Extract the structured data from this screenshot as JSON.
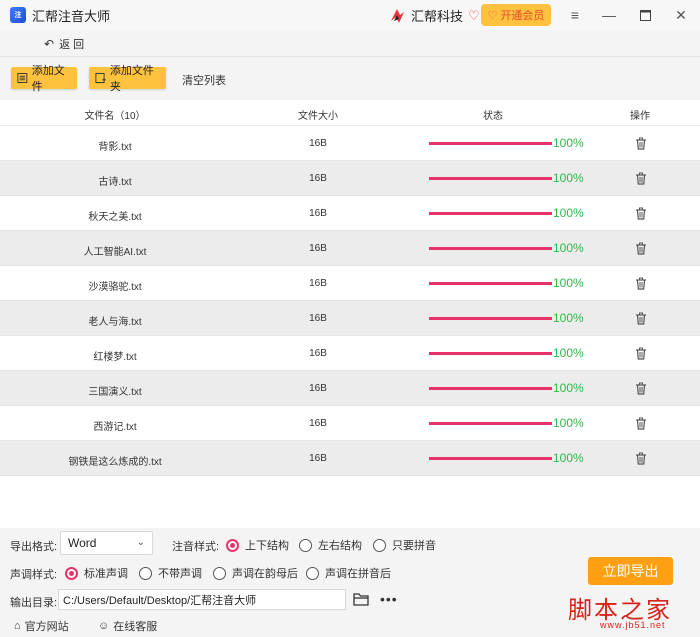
{
  "titlebar": {
    "app_title": "汇帮注音大师",
    "brand_name": "汇帮科技",
    "vip_label": "开通会员"
  },
  "nav": {
    "back_label": "返 回"
  },
  "toolbar": {
    "add_file_label": "添加文件",
    "add_folder_label": "添加文件夹",
    "clear_list_label": "清空列表"
  },
  "table": {
    "headers": {
      "filename": "文件名（10）",
      "size": "文件大小",
      "status": "状态",
      "action": "操作"
    },
    "rows": [
      {
        "name": "背影.txt",
        "size": "16B",
        "progress": 100,
        "pct": "100%"
      },
      {
        "name": "古诗.txt",
        "size": "16B",
        "progress": 100,
        "pct": "100%"
      },
      {
        "name": "秋天之美.txt",
        "size": "16B",
        "progress": 100,
        "pct": "100%"
      },
      {
        "name": "人工智能AI.txt",
        "size": "16B",
        "progress": 100,
        "pct": "100%"
      },
      {
        "name": "沙漠骆驼.txt",
        "size": "16B",
        "progress": 100,
        "pct": "100%"
      },
      {
        "name": "老人与海.txt",
        "size": "16B",
        "progress": 100,
        "pct": "100%"
      },
      {
        "name": "红楼梦.txt",
        "size": "16B",
        "progress": 100,
        "pct": "100%"
      },
      {
        "name": "三国演义.txt",
        "size": "16B",
        "progress": 100,
        "pct": "100%"
      },
      {
        "name": "西游记.txt",
        "size": "16B",
        "progress": 100,
        "pct": "100%"
      },
      {
        "name": "钢铁是这么炼成的.txt",
        "size": "16B",
        "progress": 100,
        "pct": "100%"
      }
    ]
  },
  "options": {
    "export_format_label": "导出格式:",
    "export_format_value": "Word",
    "notation_label": "注音样式:",
    "notation_options": [
      "上下结构",
      "左右结构",
      "只要拼音"
    ],
    "notation_selected": 0,
    "tone_label": "声调样式:",
    "tone_options": [
      "标准声调",
      "不带声调",
      "声调在韵母后",
      "声调在拼音后"
    ],
    "tone_selected": 0,
    "output_dir_label": "输出目录:",
    "output_dir_value": "C:/Users/Default/Desktop/汇帮注音大师",
    "export_button_label": "立即导出"
  },
  "footer": {
    "website_label": "官方网站",
    "support_label": "在线客服"
  },
  "watermark": {
    "text": "脚本之家",
    "sub": "www.jb51.net"
  },
  "colors": {
    "accent_yellow": "#ffc23e",
    "progress": "#e7336a",
    "percent_green": "#2fb84a",
    "export_orange": "#ffa012"
  }
}
